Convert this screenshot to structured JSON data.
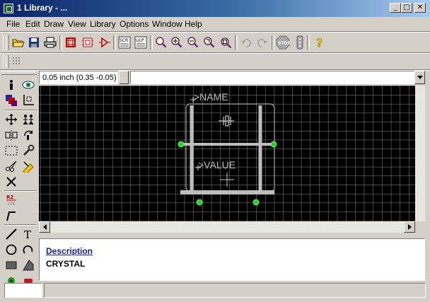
{
  "window": {
    "title": "1 Library - ...",
    "minimize_glyph": "_",
    "maximize_glyph": "□",
    "close_glyph": "✕"
  },
  "menu": [
    {
      "label": "File"
    },
    {
      "label": "Edit"
    },
    {
      "label": "Draw"
    },
    {
      "label": "View"
    },
    {
      "label": "Library"
    },
    {
      "label": "Options"
    },
    {
      "label": "Window"
    },
    {
      "label": "Help"
    }
  ],
  "toolbar": {
    "icons": [
      "open-icon",
      "save-icon",
      "print-icon",
      "script-icon",
      "schematic-icon",
      "symbol-icon",
      "scr-icon",
      "ulp-icon",
      "zoom-fit-icon",
      "zoom-in-icon",
      "zoom-out-icon",
      "zoom-redraw-icon",
      "zoom-area-icon",
      "undo-icon",
      "redo-icon",
      "stop-icon",
      "go-icon",
      "help-icon"
    ]
  },
  "coordinate": {
    "readout": "0.05 inch (0.35 -0.05)",
    "command_value": ""
  },
  "canvas": {
    "name_label": ">NAME",
    "value_label": ">VALUE",
    "grid_color": "#9a9a9a",
    "background": "#000000",
    "wire_color": "#bfbfbf",
    "pin_color": "#27c227"
  },
  "description": {
    "heading": "Description",
    "text": "CRYSTAL"
  },
  "status": {
    "left": "",
    "main": ""
  }
}
